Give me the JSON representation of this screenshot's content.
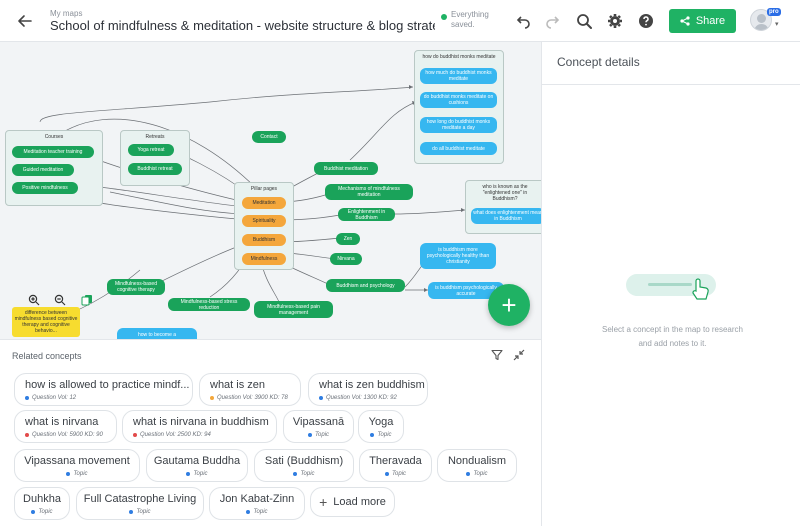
{
  "header": {
    "breadcrumb": "My maps",
    "title": "School of mindfulness & meditation - website structure & blog strategy ...",
    "save_status": "Everything saved.",
    "share_label": "Share",
    "pro_badge": "pro",
    "colors": {
      "accent": "#1fb264",
      "saved_dot": "#1fb264"
    }
  },
  "map": {
    "groups": {
      "courses": "Courses",
      "retreats": "Retreats",
      "pillar": "Pillar pages",
      "monks": "how do buddhist monks meditate",
      "enlightened": "who is known as the \"enlightened one\" in Buddhism?"
    },
    "nodes": {
      "teacher": "Meditation teacher training",
      "guided": "Guided meditation",
      "positive": "Positive mindfulness",
      "yoga_retreat": "Yoga retreat",
      "buddhist_retreat": "Buddhist retreat",
      "contact": "Contact",
      "meditation": "Meditation",
      "spirituality": "Spirituality",
      "buddhism": "Buddhism",
      "mindfulness": "Mindfulness",
      "buddhist_meditation": "Buddhist meditation",
      "mechanisms": "Mechanisms of mindfulness meditation",
      "enlightenment": "Enlightenment in Buddhism",
      "zen": "Zen",
      "nirvana": "Nirvana",
      "psychology": "Buddhism and psychology",
      "mbct": "Mindfulness-based cognitive therapy",
      "mbsr": "Mindfulness-based stress reduction",
      "mbpm": "Mindfulness-based pain management",
      "how_much": "how much do buddhist monks meditate",
      "cushions": "do buddhist monks meditate on cushions",
      "how_long": "how long do buddhist monks meditate a day",
      "do_all": "do all buddhist meditate",
      "what_does": "what does enlightenment mean in Buddhism",
      "more_psych": "is buddhism more psychologically healthy than christianity",
      "psych_accurate": "is buddhism psychologically accurate",
      "how_to_become": "how to become a",
      "difference": "difference between mindfulness based cognitive therapy and cognitive behavio..."
    },
    "colors": {
      "topic": "#1aa35a",
      "pillar": "#f4a73b",
      "question": "#36b7f0",
      "note": "#f7dc2f"
    }
  },
  "related": {
    "title": "Related concepts",
    "chips": [
      {
        "label": "how is allowed to practice mindf...",
        "sub": "Question Vol: 12",
        "dot": "#2f7de1"
      },
      {
        "label": "what is zen",
        "sub": "Question Vol: 3900 KD: 78",
        "dot": "#f4a73b"
      },
      {
        "label": "what is zen buddhism",
        "sub": "Question Vol: 1300 KD: 92",
        "dot": "#2f7de1"
      },
      {
        "label": "what is nirvana",
        "sub": "Question Vol: 5900 KD: 90",
        "dot": "#e24b4b"
      },
      {
        "label": "what is nirvana in buddhism",
        "sub": "Question Vol: 2500 KD: 94",
        "dot": "#e24b4b"
      },
      {
        "label": "Vipassanā",
        "sub": "Topic",
        "dot": "#2f7de1"
      },
      {
        "label": "Yoga",
        "sub": "Topic",
        "dot": "#2f7de1"
      },
      {
        "label": "Vipassana movement",
        "sub": "Topic",
        "dot": "#2f7de1"
      },
      {
        "label": "Gautama Buddha",
        "sub": "Topic",
        "dot": "#2f7de1"
      },
      {
        "label": "Sati (Buddhism)",
        "sub": "Topic",
        "dot": "#2f7de1"
      },
      {
        "label": "Theravada",
        "sub": "Topic",
        "dot": "#2f7de1"
      },
      {
        "label": "Nondualism",
        "sub": "Topic",
        "dot": "#2f7de1"
      },
      {
        "label": "Duhkha",
        "sub": "Topic",
        "dot": "#2f7de1"
      },
      {
        "label": "Full Catastrophe Living",
        "sub": "Topic",
        "dot": "#2f7de1"
      },
      {
        "label": "Jon Kabat-Zinn",
        "sub": "Topic",
        "dot": "#2f7de1"
      }
    ],
    "load_more": "Load more"
  },
  "details": {
    "title": "Concept details",
    "empty_text": "Select a concept in the map to research and add notes to it."
  }
}
